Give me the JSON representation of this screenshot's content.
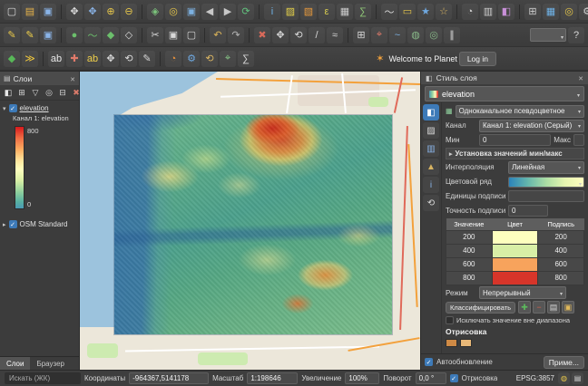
{
  "toolbar": {
    "welcome_text": "Welcome to Planet",
    "login_label": "Log in",
    "rows": [
      {
        "icons": [
          {
            "n": "new-project-icon",
            "g": "▢",
            "c": "#dcdcdc"
          },
          {
            "n": "open-project-icon",
            "g": "▤",
            "c": "#e8b54a"
          },
          {
            "n": "save-project-icon",
            "g": "▣",
            "c": "#8ab4e8"
          },
          {
            "sep": true
          },
          {
            "n": "pan-map-icon",
            "g": "✥",
            "c": "#dcdcdc"
          },
          {
            "n": "pan-to-selection-icon",
            "g": "✥",
            "c": "#8ab4e8"
          },
          {
            "n": "zoom-in-icon",
            "g": "⊕",
            "c": "#e8c84a"
          },
          {
            "n": "zoom-out-icon",
            "g": "⊖",
            "c": "#e8c84a"
          },
          {
            "sep": true
          },
          {
            "n": "zoom-full-icon",
            "g": "◈",
            "c": "#7cc47c"
          },
          {
            "n": "zoom-to-selection-icon",
            "g": "◎",
            "c": "#e8c84a"
          },
          {
            "n": "zoom-to-layer-icon",
            "g": "▣",
            "c": "#7cb0e0"
          },
          {
            "n": "zoom-last-icon",
            "g": "◀",
            "c": "#c8c8c8"
          },
          {
            "n": "zoom-next-icon",
            "g": "▶",
            "c": "#c8c8c8"
          },
          {
            "n": "map-refresh-icon",
            "g": "⟳",
            "c": "#62c27e"
          },
          {
            "sep": true
          },
          {
            "n": "identify-features-icon",
            "g": "i",
            "c": "#6fb3e8"
          },
          {
            "n": "select-features-icon",
            "g": "▨",
            "c": "#e8d44a"
          },
          {
            "n": "deselect-features-icon",
            "g": "▧",
            "c": "#e89a3c"
          },
          {
            "n": "select-by-expression-icon",
            "g": "ε",
            "c": "#d8cc50"
          },
          {
            "n": "attribute-table-icon",
            "g": "▦",
            "c": "#cccccc"
          },
          {
            "n": "field-calculator-icon",
            "g": "∑",
            "c": "#90c878"
          },
          {
            "sep": true
          },
          {
            "n": "measure-icon",
            "g": "〜",
            "c": "#d8d8d8"
          },
          {
            "n": "map-tips-icon",
            "g": "▭",
            "c": "#e8c84a"
          },
          {
            "n": "new-bookmark-icon",
            "g": "★",
            "c": "#6fa8e0"
          },
          {
            "n": "show-bookmarks-icon",
            "g": "☆",
            "c": "#d8b462"
          },
          {
            "sep": true
          },
          {
            "n": "temporal-controller-icon",
            "g": "◔",
            "c": "#d0d0d0"
          },
          {
            "n": "layout-manager-icon",
            "g": "▥",
            "c": "#d0d0d0"
          },
          {
            "n": "style-manager-icon",
            "g": "◧",
            "c": "#c890d8"
          },
          {
            "sep": true
          },
          {
            "n": "new-map-view-icon",
            "g": "⊞",
            "c": "#cfcfcf"
          },
          {
            "n": "data-source-manager-icon",
            "g": "▦",
            "c": "#6fb3e8"
          },
          {
            "n": "search-icon",
            "g": "◎",
            "c": "#e8c84a"
          },
          {
            "n": "options-icon",
            "g": "⚙",
            "c": "#cfcfcf"
          }
        ]
      },
      {
        "icons": [
          {
            "n": "current-edits-icon",
            "g": "✎",
            "c": "#e8c84a"
          },
          {
            "n": "toggle-editing-icon",
            "g": "✎",
            "c": "#f0d04a"
          },
          {
            "n": "save-edits-icon",
            "g": "▣",
            "c": "#8ab4e8"
          },
          {
            "sep": true
          },
          {
            "n": "add-point-feature-icon",
            "g": "●",
            "c": "#6cbf6c"
          },
          {
            "n": "add-line-feature-icon",
            "g": "〜",
            "c": "#6cbf6c"
          },
          {
            "n": "add-polygon-feature-icon",
            "g": "◆",
            "c": "#6cbf6c"
          },
          {
            "n": "vertex-tool-icon",
            "g": "◇",
            "c": "#d8d8d8"
          },
          {
            "sep": true
          },
          {
            "n": "cut-features-icon",
            "g": "✂",
            "c": "#d8d8d8"
          },
          {
            "n": "copy-features-icon",
            "g": "▣",
            "c": "#d8d8d8"
          },
          {
            "n": "paste-features-icon",
            "g": "▢",
            "c": "#d8d8d8"
          },
          {
            "sep": true
          },
          {
            "n": "undo-icon",
            "g": "↶",
            "c": "#e0b85a"
          },
          {
            "n": "redo-icon",
            "g": "↷",
            "c": "#b8b8b8"
          },
          {
            "sep": true
          },
          {
            "n": "delete-selected-icon",
            "g": "✖",
            "c": "#d86a5a"
          },
          {
            "n": "move-feature-icon",
            "g": "✥",
            "c": "#d8d8d8"
          },
          {
            "n": "rotate-feature-icon",
            "g": "⟲",
            "c": "#d8d8d8"
          },
          {
            "n": "split-features-icon",
            "g": "/",
            "c": "#d8d8d8"
          },
          {
            "n": "reshape-features-icon",
            "g": "≈",
            "c": "#d8d8d8"
          },
          {
            "sep": true
          },
          {
            "n": "merge-features-icon",
            "g": "⊞",
            "c": "#d8d8d8"
          },
          {
            "n": "snapping-options-icon",
            "g": "⌖",
            "c": "#e07a6a"
          },
          {
            "n": "trace-icon",
            "g": "~",
            "c": "#7cb0e0"
          },
          {
            "n": "add-ring-icon",
            "g": "◍",
            "c": "#88b888"
          },
          {
            "n": "add-part-icon",
            "g": "◎",
            "c": "#88b888"
          },
          {
            "n": "offset-curve-icon",
            "g": "∥",
            "c": "#d8d8d8"
          }
        ]
      },
      {
        "icons": [
          {
            "n": "plugin-manager-icon",
            "g": "◆",
            "c": "#58b858"
          },
          {
            "n": "python-console-icon",
            "g": "≫",
            "c": "#f0c83c"
          },
          {
            "sep": true
          },
          {
            "n": "label-toolbar-icon",
            "g": "ab",
            "c": "#e8e8e8"
          },
          {
            "n": "pin-labels-icon",
            "g": "✚",
            "c": "#e07a6a"
          },
          {
            "n": "highlight-labels-icon",
            "g": "ab",
            "c": "#f0d04a"
          },
          {
            "n": "move-label-icon",
            "g": "✥",
            "c": "#d8d8d8"
          },
          {
            "n": "rotate-label-icon",
            "g": "⟲",
            "c": "#d8d8d8"
          },
          {
            "n": "change-label-icon",
            "g": "✎",
            "c": "#d8d8d8"
          },
          {
            "sep": true
          },
          {
            "n": "diagram-options-icon",
            "g": "◔",
            "c": "#e8913c"
          },
          {
            "n": "processing-toolbox-icon",
            "g": "⚙",
            "c": "#6fa8e0"
          },
          {
            "n": "processing-history-icon",
            "g": "⟲",
            "c": "#d8b462"
          },
          {
            "n": "georeferencer-icon",
            "g": "⌖",
            "c": "#88c888"
          },
          {
            "n": "statistics-icon",
            "g": "∑",
            "c": "#d8d8d8"
          }
        ]
      }
    ]
  },
  "layers_panel": {
    "title": "Слои",
    "toolbar_icons": [
      {
        "n": "open-layer-styling-icon",
        "g": "◧",
        "c": "#e8e8e8"
      },
      {
        "n": "add-group-icon",
        "g": "⊞",
        "c": "#d8d8d8"
      },
      {
        "n": "filter-legend-icon",
        "g": "▽",
        "c": "#d8d8d8"
      },
      {
        "n": "map-themes-icon",
        "g": "◎",
        "c": "#d8d8d8"
      },
      {
        "n": "collapse-all-icon",
        "g": "⊟",
        "c": "#d8d8d8"
      },
      {
        "n": "remove-layer-icon",
        "g": "✖",
        "c": "#d87a6a"
      }
    ],
    "layers": [
      {
        "name": "elevation",
        "band_label": "Канал 1: elevation",
        "legend": {
          "max": "800",
          "min": "0"
        }
      },
      {
        "name": "OSM Standard"
      }
    ],
    "tabs": [
      "Слои",
      "Браузер"
    ]
  },
  "style_panel": {
    "title": "Стиль слоя",
    "layer_selector": "elevation",
    "side_icons": [
      {
        "n": "symbology-tab-icon",
        "g": "◧",
        "c": "#ffffff",
        "sel": true
      },
      {
        "n": "transparency-tab-icon",
        "g": "▨",
        "c": "#d8d8d8"
      },
      {
        "n": "histogram-tab-icon",
        "g": "▥",
        "c": "#8ab4e8"
      },
      {
        "n": "pyramids-tab-icon",
        "g": "▲",
        "c": "#d8b462"
      },
      {
        "n": "metadata-tab-icon",
        "g": "i",
        "c": "#8ab4e8"
      },
      {
        "n": "history-tab-icon",
        "g": "⟲",
        "c": "#d8d8d8"
      }
    ],
    "renderer": "Одноканальное псевдоцветное",
    "fields": {
      "band_label": "Канал",
      "band_value": "Канал 1: elevation (Серый)",
      "min_label": "Мин",
      "min_value": "0",
      "max_label": "Макс",
      "minmax_settings": "Установка значений мин/макс",
      "interpolation_label": "Интерполяция",
      "interpolation_value": "Линейная",
      "color_ramp_label": "Цветовой ряд",
      "label_unit_label": "Единицы подписи",
      "label_precision_label": "Точность подписи",
      "label_precision_value": "0"
    },
    "table": {
      "headers": [
        "Значение",
        "Цвет",
        "Подпись"
      ],
      "rows": [
        {
          "value": "200",
          "color": "#fdffbe",
          "label": "200"
        },
        {
          "value": "400",
          "color": "#d8efa6",
          "label": "400"
        },
        {
          "value": "600",
          "color": "#f7a35c",
          "label": "600"
        },
        {
          "value": "800",
          "color": "#d7352a",
          "label": "800"
        }
      ]
    },
    "mode_label": "Режим",
    "mode_value": "Непрерывный",
    "classify_label": "Классифицировать",
    "classify_buttons": [
      {
        "n": "add-value-button",
        "g": "✚",
        "c": "#5cb85c"
      },
      {
        "n": "remove-value-button",
        "g": "−",
        "c": "#d8604a"
      },
      {
        "n": "load-color-map-button",
        "g": "▤",
        "c": "#d8d8d8"
      },
      {
        "n": "save-color-map-button",
        "g": "▣",
        "c": "#e0b85a"
      }
    ],
    "exclude_label": "Исключать значение вне диапазона",
    "rendering_label": "Отрисовка",
    "rendering_swatches": [
      "#cf8a45",
      "#e8b878"
    ],
    "live_update_label": "Автообновление",
    "apply_label": "Приме..."
  },
  "status_bar": {
    "search": "Искать (ЖК)",
    "coords_label": "Координаты",
    "coords_value": "-964367,5141178",
    "scale_label": "Масштаб",
    "scale_value": "1:198646",
    "magnifier_label": "Увеличение",
    "magnifier_value": "100%",
    "rotation_label": "Поворот",
    "rotation_value": "0,0 °",
    "render_label": "Отрисовка",
    "crs": "EPSG:3857",
    "icons": [
      {
        "n": "crs-icon",
        "g": "◍",
        "c": "#e8c84a"
      },
      {
        "n": "log-messages-icon",
        "g": "▤",
        "c": "#d8d8d8"
      }
    ]
  }
}
